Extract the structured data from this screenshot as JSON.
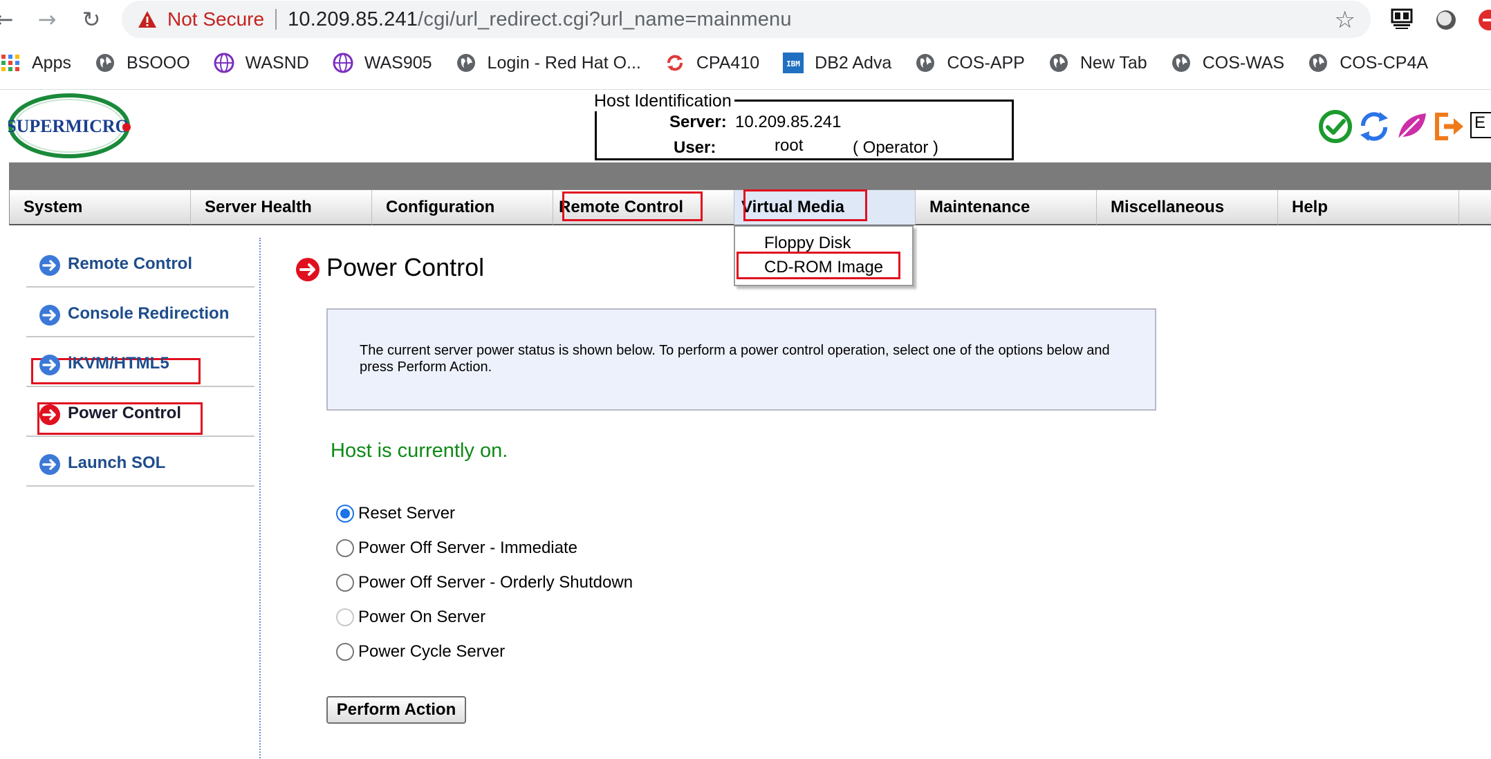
{
  "browser": {
    "security_label": "Not Secure",
    "url_host": "10.209.85.241",
    "url_path": "/cgi/url_redirect.cgi?url_name=mainmenu",
    "bookmarks": [
      {
        "label": "Apps",
        "icon": "apps-grid-icon"
      },
      {
        "label": "BSOOO",
        "icon": "globe-icon"
      },
      {
        "label": "WASND",
        "icon": "purple-globe-icon"
      },
      {
        "label": "WAS905",
        "icon": "purple-globe-icon"
      },
      {
        "label": "Login - Red Hat O...",
        "icon": "globe-icon"
      },
      {
        "label": "CPA410",
        "icon": "red-sync-icon"
      },
      {
        "label": "DB2 Adva",
        "icon": "ibm-icon"
      },
      {
        "label": "COS-APP",
        "icon": "globe-icon"
      },
      {
        "label": "New Tab",
        "icon": "globe-icon"
      },
      {
        "label": "COS-WAS",
        "icon": "globe-icon"
      },
      {
        "label": "COS-CP4A",
        "icon": "globe-icon"
      }
    ]
  },
  "header": {
    "logo_text": "SUPERMICRO",
    "host_legend": "Host Identification",
    "server_label": "Server:",
    "server_value": "10.209.85.241",
    "user_label": "User:",
    "user_value": "root",
    "user_role": "( Operator )",
    "lang_partial": "E"
  },
  "menu": {
    "items": [
      "System",
      "Server Health",
      "Configuration",
      "Remote Control",
      "Virtual Media",
      "Maintenance",
      "Miscellaneous",
      "Help"
    ],
    "dropdown": [
      "Floppy Disk",
      "CD-ROM Image"
    ]
  },
  "sidebar": {
    "items": [
      "Remote Control",
      "Console Redirection",
      "iKVM/HTML5",
      "Power Control",
      "Launch SOL"
    ]
  },
  "main": {
    "title": "Power Control",
    "info": "The current server power status is shown below. To perform a power control operation, select one of the options below and press Perform Action.",
    "status": "Host is currently on.",
    "options": [
      "Reset Server",
      "Power Off Server - Immediate",
      "Power Off Server - Orderly Shutdown",
      "Power On Server",
      "Power Cycle Server"
    ],
    "selected_option": "Reset Server",
    "disabled_option": "Power On Server",
    "action_label": "Perform Action"
  },
  "colors": {
    "highlight": "#e0101e",
    "status_green": "#0e8a16",
    "link_blue": "#1e4d8c"
  }
}
